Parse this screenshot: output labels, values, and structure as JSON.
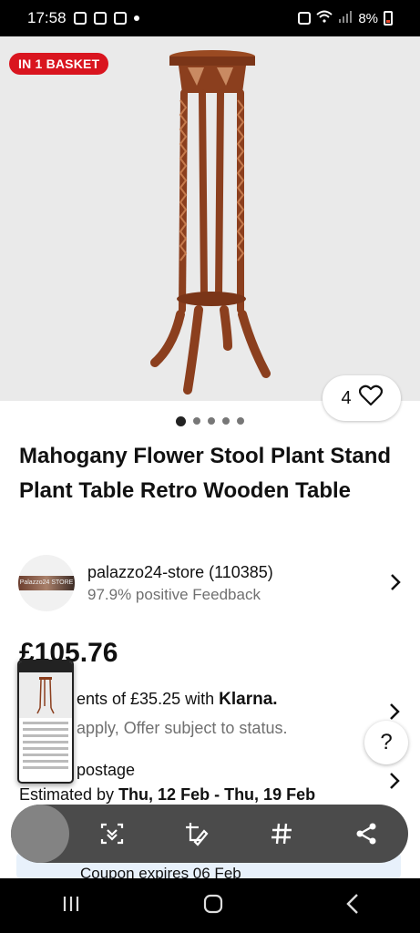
{
  "status_bar": {
    "time": "17:58",
    "battery": "8%"
  },
  "hero": {
    "badge": "IN 1 BASKET",
    "watch_count": "4",
    "image_count": 5,
    "active_image_index": 0
  },
  "product": {
    "title": "Mahogany Flower Stool Plant Stand Plant Table Retro Wooden Table",
    "price": "£105.76"
  },
  "seller": {
    "name": "palazzo24-store (110385)",
    "feedback": "97.9% positive Feedback",
    "logo_text": "Palazzo24 STORE"
  },
  "payments": {
    "klarna_prefix": "ents of £35.25 with",
    "klarna_brand": "Klarna.",
    "offer_text": "apply, Offer subject to status."
  },
  "shipping": {
    "postage": "postage",
    "estimated_label": "Estimated by",
    "estimated_dates": "Thu, 12 Feb - Thu, 19 Feb"
  },
  "coupon": {
    "text": "Coupon expires 06 Feb"
  },
  "help": {
    "label": "?"
  },
  "capture_toolbar": {
    "icons": [
      "scroll-capture-icon",
      "crop-edit-icon",
      "hashtag-icon",
      "share-icon"
    ]
  },
  "nav": {
    "icons": [
      "recent-apps-icon",
      "home-icon",
      "back-icon"
    ]
  },
  "colors": {
    "badge_red": "#d9151f",
    "hero_bg": "#eaeaea",
    "wood": "#8b3f1e"
  }
}
